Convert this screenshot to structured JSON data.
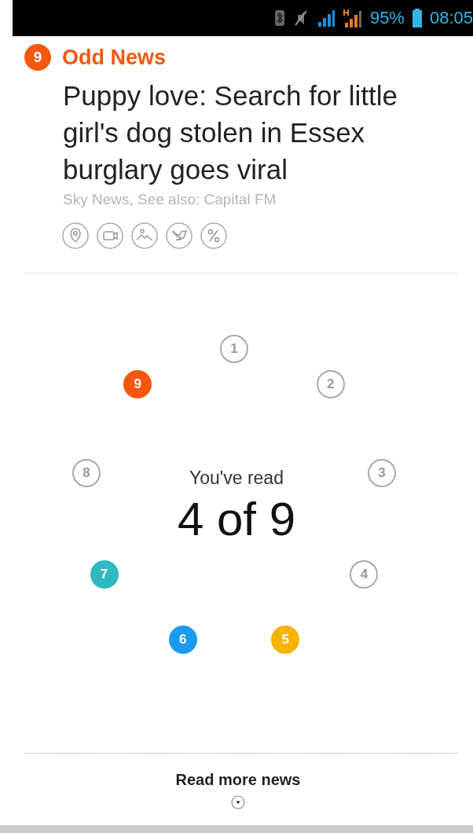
{
  "status_bar": {
    "battery": "95%",
    "time": "08:05"
  },
  "story": {
    "number": "9",
    "category": "Odd News",
    "headline": "Puppy love: Search for little girl's dog stolen in Essex burglary goes viral",
    "source": "Sky News, See also: Capital FM",
    "actions": [
      {
        "kind": "location"
      },
      {
        "kind": "video"
      },
      {
        "kind": "image"
      },
      {
        "kind": "twitter"
      },
      {
        "kind": "percent"
      }
    ]
  },
  "progress": {
    "label": "You've read",
    "count": "4 of 9",
    "stories": [
      {
        "number": "1",
        "read": false
      },
      {
        "number": "2",
        "read": false
      },
      {
        "number": "3",
        "read": false
      },
      {
        "number": "4",
        "read": false
      },
      {
        "number": "5",
        "read": true,
        "color": "#f5b400"
      },
      {
        "number": "6",
        "read": true,
        "color": "#1a9bf0"
      },
      {
        "number": "7",
        "read": true,
        "color": "#2fb9c1"
      },
      {
        "number": "8",
        "read": false
      },
      {
        "number": "9",
        "read": true,
        "color": "#f4580e"
      }
    ]
  },
  "footer": {
    "label": "Read more news"
  }
}
